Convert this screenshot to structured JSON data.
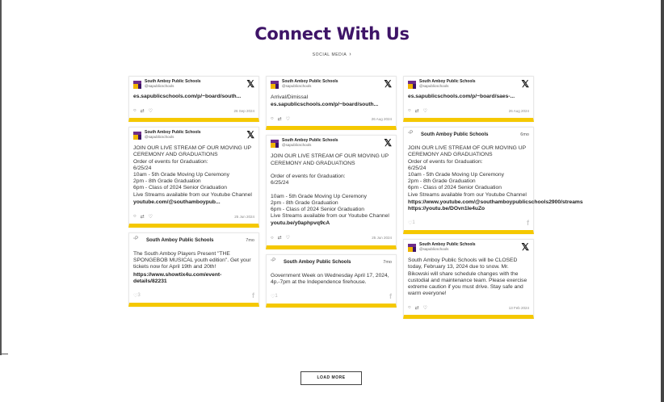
{
  "header": {
    "title": "Connect With Us",
    "social_link": "SOCIAL MEDIA"
  },
  "columns": [
    [
      {
        "type": "x",
        "name": "South Amboy Public Schools",
        "handle": "@sapublicschools",
        "text": "",
        "link": "es.sapublicschools.com/p/~board/south...",
        "date": "26 Sep 2024"
      },
      {
        "type": "x",
        "name": "South Amboy Public Schools",
        "handle": "@sapublicschools",
        "text": "JOIN OUR LIVE STREAM OF OUR MOVING UP CEREMONY AND GRADUATIONS\nOrder of events for Graduation:\n6/25/24\n10am - 5th Grade Moving Up Ceremony\n2pm - 8th Grade Graduation\n6pm - Class of 2024 Senior Graduation\nLive Streams available from our Youtube Channel",
        "link": "youtube.com/@southamboypub...",
        "date": "25 Jun 2024"
      },
      {
        "type": "fb",
        "name": "South Amboy Public Schools",
        "ago": "7mo",
        "text": "The South Amboy Players Present \"THE SPONGEBOB MUSICAL youth edition\". Get your tickets now for April 19th and 20th!",
        "link": "https://www.showtix4u.com/event-details/82231",
        "likes": "3"
      }
    ],
    [
      {
        "type": "x",
        "name": "South Amboy Public Schools",
        "handle": "@sapublicschools",
        "text": "Arrival/Dimissal",
        "link": "es.sapublicschools.com/p/~board/south...",
        "date": "26 Aug 2024"
      },
      {
        "type": "x",
        "name": "South Amboy Public Schools",
        "handle": "@sapublicschools",
        "text": "JOIN OUR LIVE STREAM OF OUR MOVING UP CEREMONY AND GRADUATIONS\n\nOrder of events for Graduation:\n6/25/24\n\n10am - 5th Grade Moving Up Ceremony\n2pm - 8th Grade Graduation\n6pm - Class of 2024 Senior Graduation\nLive Streams available from our Youtube Channel\n",
        "link": "youtu.be/y0aphpvq9cA",
        "date": "25 Jun 2024"
      },
      {
        "type": "fb",
        "name": "South Amboy Public Schools",
        "ago": "7mo",
        "text": "Government Week on Wednesday April 17, 2024, 4p.-7pm at the Independence firehouse.",
        "link": "",
        "likes": "1"
      }
    ],
    [
      {
        "type": "x",
        "name": "South Amboy Public Schools",
        "handle": "@sapublicschools",
        "text": "",
        "link": "es.sapublicschools.com/p/~board/saes-...",
        "date": "26 Aug 2024"
      },
      {
        "type": "fb",
        "name": "South Amboy Public Schools",
        "ago": "6mo",
        "text": "JOIN OUR LIVE STREAM OF OUR MOVING UP CEREMONY AND GRADUATIONS\nOrder of events for Graduation:\n6/25/24\n10am - 5th Grade Moving Up Ceremony\n2pm - 8th Grade Graduation\n6pm - Class of 2024 Senior Graduation\nLive Streams available from our Youtube Channel",
        "link": "https://www.youtube.com/@southamboypublicschools2900/streams\nhttps://youtu.be/DOvn1le4uZo",
        "likes": "1"
      },
      {
        "type": "x",
        "name": "South Amboy Public Schools",
        "handle": "@sapublicschools",
        "text": "South Amboy Public Schools will be CLOSED today, February 13, 2024 due to snow. Mr. Bikowski will share schedule changes with the custodial and maintenance team. Please exercise extreme caution if you must drive.  Stay safe and warm everyone!",
        "link": "",
        "date": "13 Feb 2024"
      }
    ]
  ],
  "load_more": "LOAD MORE",
  "colors": {
    "title": "#3e1467",
    "accent": "#f5c800"
  }
}
